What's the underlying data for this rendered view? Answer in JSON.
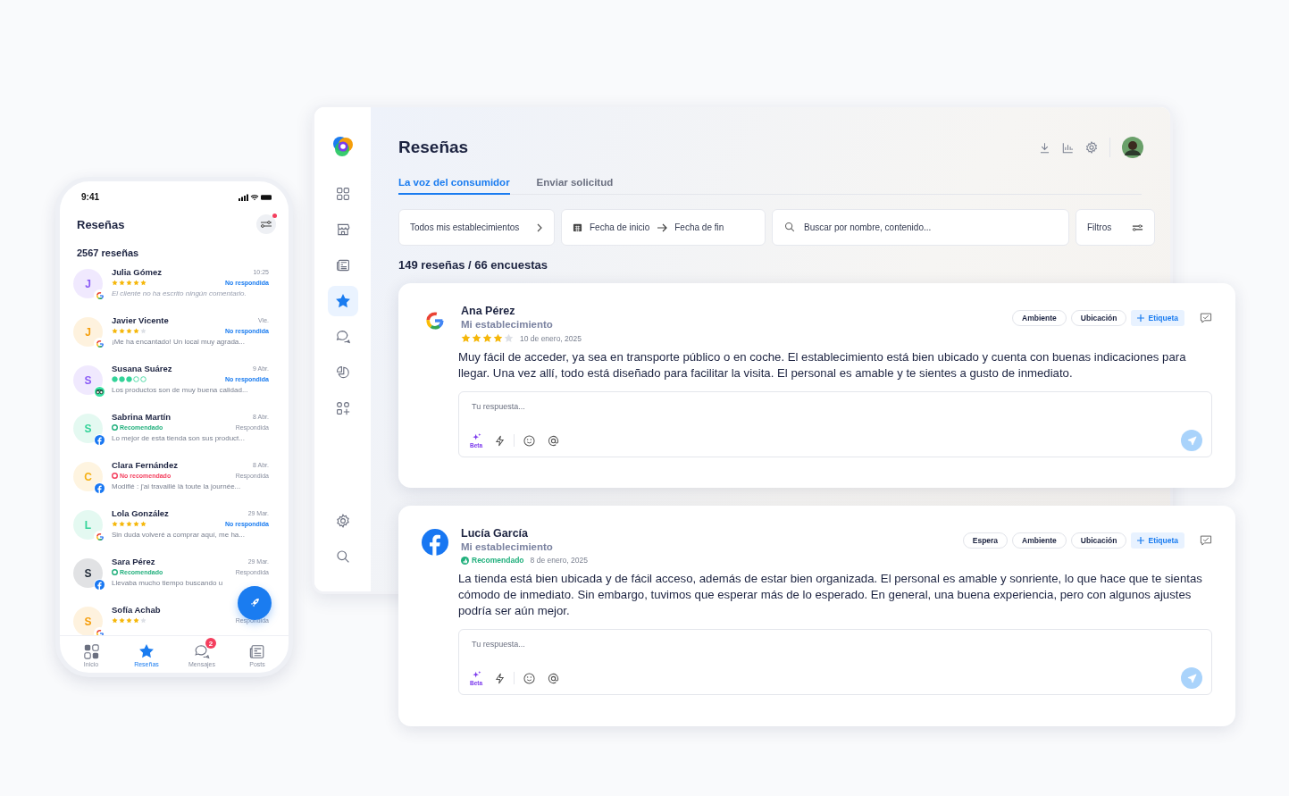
{
  "phone": {
    "time": "9:41",
    "title": "Reseñas",
    "filter_alert": true,
    "count": "2567 reseñas",
    "reviews": [
      {
        "name": "Julia Gómez",
        "initial": "J",
        "color": "#8b5cf6",
        "kind": "google",
        "rating": {
          "kind": "stars",
          "stars": 5
        },
        "time": "10:25",
        "status": "No respondida",
        "answered": false,
        "preview": "El cliente no ha escrito ningún comentario.",
        "no_comment": true
      },
      {
        "name": "Javier Vicente",
        "initial": "J",
        "color": "#f59e0b",
        "kind": "google",
        "rating": {
          "kind": "stars",
          "stars": 4
        },
        "time": "Vie.",
        "status": "No respondida",
        "answered": false,
        "preview": "¡Me ha encantado! Un local muy agrada...",
        "no_comment": false
      },
      {
        "name": "Susana Suárez",
        "initial": "S",
        "color": "#8b5cf6",
        "kind": "tripadvisor",
        "rating": {
          "kind": "bubbles",
          "stars": 3
        },
        "time": "9 Abr.",
        "status": "No respondida",
        "answered": false,
        "preview": "Los productos son de muy buena calidad...",
        "no_comment": false
      },
      {
        "name": "Sabrina Martín",
        "initial": "S",
        "color": "#34d399",
        "kind": "facebook",
        "rating": {
          "kind": "recommendation",
          "recommended": true,
          "label": "Recomendado"
        },
        "time": "8 Abr.",
        "status": "Respondida",
        "answered": true,
        "preview": "Lo mejor de esta tienda son sus product...",
        "no_comment": false
      },
      {
        "name": "Clara Fernández",
        "initial": "C",
        "color": "#f5b014",
        "kind": "facebook",
        "rating": {
          "kind": "recommendation",
          "recommended": false,
          "label": "No recomendado"
        },
        "time": "8 Abr.",
        "status": "Respondida",
        "answered": true,
        "preview": "Modifié : j'ai travaillé là toute la journée...",
        "no_comment": false
      },
      {
        "name": "Lola González",
        "initial": "L",
        "color": "#34d399",
        "kind": "google",
        "rating": {
          "kind": "stars",
          "stars": 5
        },
        "time": "29 Mar.",
        "status": "No respondida",
        "answered": false,
        "preview": "Sin duda volveré a comprar aquí, me ha...",
        "no_comment": false
      },
      {
        "name": "Sara Pérez",
        "initial": "S",
        "color": "#1f2937",
        "kind": "facebook",
        "rating": {
          "kind": "recommendation",
          "recommended": true,
          "label": "Recomendado"
        },
        "time": "29 Mar.",
        "status": "Respondida",
        "answered": true,
        "preview": "Llevaba mucho tiempo buscando u",
        "no_comment": false
      },
      {
        "name": "Sofía Achab",
        "initial": "S",
        "color": "#f59e0b",
        "kind": "google",
        "rating": {
          "kind": "stars",
          "stars": 4
        },
        "status": "Respondida",
        "answered": true
      }
    ],
    "tabs": [
      {
        "label": "Inicio",
        "selected": false
      },
      {
        "label": "Reseñas",
        "selected": true
      },
      {
        "label": "Mensajes",
        "selected": false,
        "badge": "2"
      },
      {
        "label": "Posts",
        "selected": false
      }
    ]
  },
  "desktop": {
    "sidebar": {
      "items": [
        {
          "selected": false
        },
        {
          "selected": false
        },
        {
          "selected": false
        },
        {
          "selected": true
        },
        {
          "selected": false
        },
        {
          "selected": false
        },
        {
          "selected": false
        }
      ]
    },
    "title": "Reseñas",
    "tabs": [
      {
        "label": "La voz del consumidor",
        "selected": true
      },
      {
        "label": "Enviar solicitud",
        "selected": false
      }
    ],
    "filters": {
      "establishments": "Todos mis establecimientos",
      "date_start": "Fecha de inicio",
      "date_end": "Fecha de fin",
      "search_placeholder": "Buscar por nombre, contenido...",
      "filters": "Filtros"
    },
    "summary": "149 reseñas / 66 encuestas",
    "reviews": [
      {
        "kind": "google",
        "name": "Ana Pérez",
        "place": "Mi establecimiento",
        "rating": {
          "kind": "stars",
          "stars": 4
        },
        "date": "10 de enero, 2025",
        "tags": [
          "Ambiente",
          "Ubicación"
        ],
        "add_tag": "Etiqueta",
        "text": "Muy fácil de acceder, ya sea en transporte público o en coche. El establecimiento está bien ubicado y cuenta con buenas indicaciones para llegar. Una vez allí, todo está diseñado para facilitar la visita. El personal es amable y te sientes a gusto de inmediato.",
        "reply_placeholder": "Tu respuesta...",
        "beta": "Beta"
      },
      {
        "kind": "facebook",
        "name": "Lucía García",
        "place": "Mi establecimiento",
        "rating": {
          "kind": "recommendation",
          "recommended": true,
          "label": "Recomendado"
        },
        "date": "8 de enero, 2025",
        "tags": [
          "Espera",
          "Ambiente",
          "Ubicación"
        ],
        "add_tag": "Etiqueta",
        "text": "La tienda está bien ubicada y de fácil acceso, además de estar bien organizada. El personal es amable y sonriente, lo que hace que te sientas cómodo de inmediato. Sin embargo, tuvimos que esperar más de lo esperado. En general, una buena experiencia, pero con algunos ajustes podría ser aún mejor.",
        "reply_placeholder": "Tu respuesta...",
        "beta": "Beta"
      }
    ]
  }
}
